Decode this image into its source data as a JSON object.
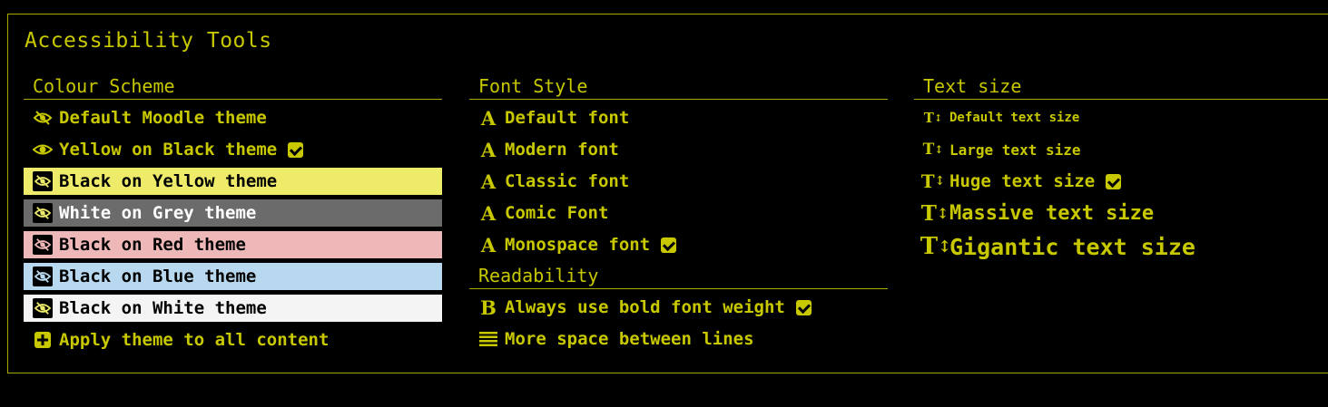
{
  "panel": {
    "title": "Accessibility Tools"
  },
  "colour_scheme": {
    "heading": "Colour Scheme",
    "items": [
      {
        "label": "Default Moodle theme",
        "icon": "theme-icon",
        "selected": false
      },
      {
        "label": "Yellow on Black theme",
        "icon": "eye-icon",
        "selected": true
      },
      {
        "label": "Black on Yellow theme",
        "icon": "theme-icon",
        "selected": false,
        "background": "#eeea6a"
      },
      {
        "label": "White on Grey theme",
        "icon": "theme-icon",
        "selected": false,
        "background": "#6b6b6b"
      },
      {
        "label": "Black on Red theme",
        "icon": "theme-icon",
        "selected": false,
        "background": "#efb8b8"
      },
      {
        "label": "Black on Blue theme",
        "icon": "theme-icon",
        "selected": false,
        "background": "#b7d8ee"
      },
      {
        "label": "Black on White theme",
        "icon": "theme-icon",
        "selected": false,
        "background": "#f4f4f4"
      }
    ],
    "apply_all": {
      "label": "Apply theme to all content",
      "icon": "plus-square-icon"
    }
  },
  "font_style": {
    "heading": "Font Style",
    "items": [
      {
        "label": "Default font",
        "icon": "font-a-icon",
        "selected": false
      },
      {
        "label": "Modern font",
        "icon": "font-a-icon",
        "selected": false
      },
      {
        "label": "Classic font",
        "icon": "font-a-icon",
        "selected": false
      },
      {
        "label": "Comic Font",
        "icon": "font-a-icon",
        "selected": false
      },
      {
        "label": "Monospace font",
        "icon": "font-a-icon",
        "selected": true
      }
    ]
  },
  "readability": {
    "heading": "Readability",
    "items": [
      {
        "label": "Always use bold font weight",
        "icon": "bold-b-icon",
        "selected": true
      },
      {
        "label": "More space between lines",
        "icon": "line-spacing-icon",
        "selected": false
      }
    ]
  },
  "text_size": {
    "heading": "Text size",
    "items": [
      {
        "label": "Default text size",
        "icon": "text-size-icon",
        "selected": false
      },
      {
        "label": "Large text size",
        "icon": "text-size-icon",
        "selected": false
      },
      {
        "label": "Huge text size",
        "icon": "text-size-icon",
        "selected": true
      },
      {
        "label": "Massive text size",
        "icon": "text-size-icon",
        "selected": false
      },
      {
        "label": "Gigantic text size",
        "icon": "text-size-icon",
        "selected": false
      }
    ]
  },
  "colors": {
    "accent": "#c8c800",
    "background": "#000000",
    "border": "#a8a800"
  }
}
